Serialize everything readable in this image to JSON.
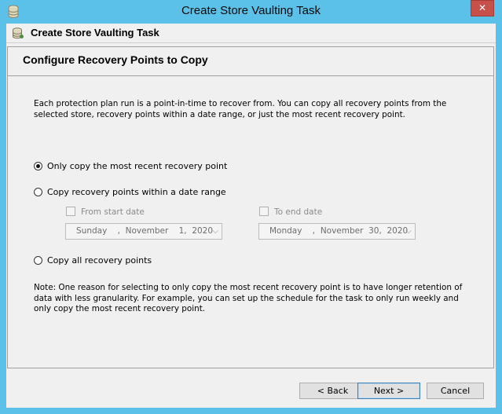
{
  "window": {
    "title": "Create Store Vaulting Task",
    "close_label": "✕"
  },
  "header": {
    "title": "Create Store Vaulting Task",
    "icon": "database-icon"
  },
  "panel": {
    "title": "Configure Recovery Points to Copy",
    "description": "Each protection plan run is a point-in-time to recover from. You can copy all recovery points from the selected store, recovery points within a date range, or just the most recent recovery point."
  },
  "options": {
    "recent": {
      "label": "Only copy the most recent recovery point",
      "checked": true
    },
    "range": {
      "label": "Copy recovery points within a date range",
      "checked": false
    },
    "all": {
      "label": "Copy all recovery points",
      "checked": false
    }
  },
  "range": {
    "start_label": "From start date",
    "start_value": "Sunday    ,  November    1,  2020",
    "end_label": "To end date",
    "end_value": "Monday    ,  November  30,  2020",
    "dropdown_glyph": "⌵"
  },
  "note": "Note: One reason for selecting to only copy the most recent recovery point is to have longer retention of data with less granularity. For example, you can set up the schedule for the task to only run weekly and only copy the most recent recovery point.",
  "buttons": {
    "back": "< Back",
    "next": "Next >",
    "cancel": "Cancel"
  },
  "colors": {
    "titlebar": "#5bc1e8",
    "close": "#c7504b",
    "panel_bg": "#f0f0f0"
  }
}
